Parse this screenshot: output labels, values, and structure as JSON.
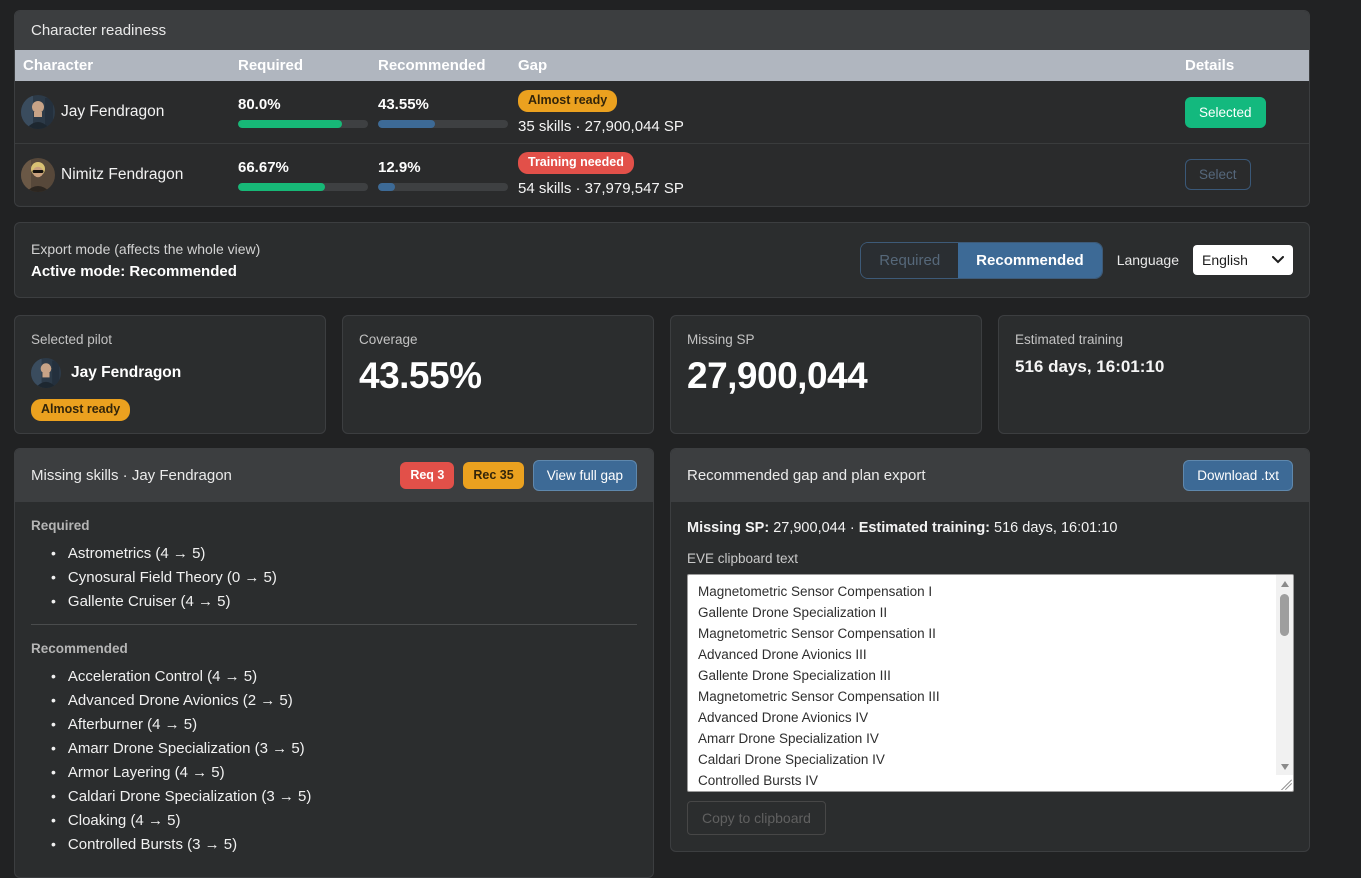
{
  "colors": {
    "green": "#17b877",
    "steel_blue": "#3d6a96",
    "orange": "#eba11f",
    "red": "#e25049",
    "selected_green": "#13b97e",
    "table_header_gray": "#b0b6bf"
  },
  "readiness": {
    "title": "Character readiness",
    "columns": {
      "character": "Character",
      "required": "Required",
      "recommended": "Recommended",
      "gap": "Gap",
      "details": "Details"
    },
    "rows": [
      {
        "name": "Jay Fendragon",
        "required_pct": "80.0%",
        "required_value": 80.0,
        "recommended_pct": "43.55%",
        "recommended_value": 43.55,
        "gap_badge": "Almost ready",
        "gap_text": "35 skills · 27,900,044 SP",
        "details_button": "Selected"
      },
      {
        "name": "Nimitz Fendragon",
        "required_pct": "66.67%",
        "required_value": 66.67,
        "recommended_pct": "12.9%",
        "recommended_value": 12.9,
        "gap_badge": "Training needed",
        "gap_text": "54 skills · 37,979,547 SP",
        "details_button": "Select"
      }
    ]
  },
  "export_mode": {
    "label": "Export mode (affects the whole view)",
    "active_text": "Active mode: Recommended",
    "toggle": {
      "required_label": "Required",
      "recommended_label": "Recommended",
      "active": "Recommended"
    },
    "language_label": "Language",
    "language_value": "English"
  },
  "stats": {
    "selected_pilot": {
      "label": "Selected pilot",
      "name": "Jay Fendragon",
      "badge": "Almost ready"
    },
    "coverage": {
      "label": "Coverage",
      "value": "43.55%"
    },
    "missing_sp": {
      "label": "Missing SP",
      "value": "27,900,044"
    },
    "estimated_training": {
      "label": "Estimated training",
      "value": "516 days, 16:01:10"
    }
  },
  "missing_skills": {
    "title": "Missing skills · Jay Fendragon",
    "req_badge": "Req 3",
    "rec_badge": "Rec 35",
    "view_full_gap_button": "View full gap",
    "required_label": "Required",
    "required_items": [
      "Astrometrics (4 → 5)",
      "Cynosural Field Theory (0 → 5)",
      "Gallente Cruiser (4 → 5)"
    ],
    "recommended_label": "Recommended",
    "recommended_items": [
      "Acceleration Control (4 → 5)",
      "Advanced Drone Avionics (2 → 5)",
      "Afterburner (4 → 5)",
      "Amarr Drone Specialization (3 → 5)",
      "Armor Layering (4 → 5)",
      "Caldari Drone Specialization (3 → 5)",
      "Cloaking (4 → 5)",
      "Controlled Bursts (3 → 5)"
    ]
  },
  "export_panel": {
    "title": "Recommended gap and plan export",
    "download_button": "Download .txt",
    "summary_sp_label": "Missing SP:",
    "summary_sp_value": " 27,900,044 · ",
    "summary_training_label": "Estimated training:",
    "summary_training_value": " 516 days, 16:01:10",
    "clipboard_label": "EVE clipboard text",
    "clipboard_lines": [
      "Magnetometric Sensor Compensation I",
      "Gallente Drone Specialization II",
      "Magnetometric Sensor Compensation II",
      "Advanced Drone Avionics III",
      "Gallente Drone Specialization III",
      "Magnetometric Sensor Compensation III",
      "Advanced Drone Avionics IV",
      "Amarr Drone Specialization IV",
      "Caldari Drone Specialization IV",
      "Controlled Bursts IV"
    ],
    "copy_button": "Copy to clipboard"
  }
}
